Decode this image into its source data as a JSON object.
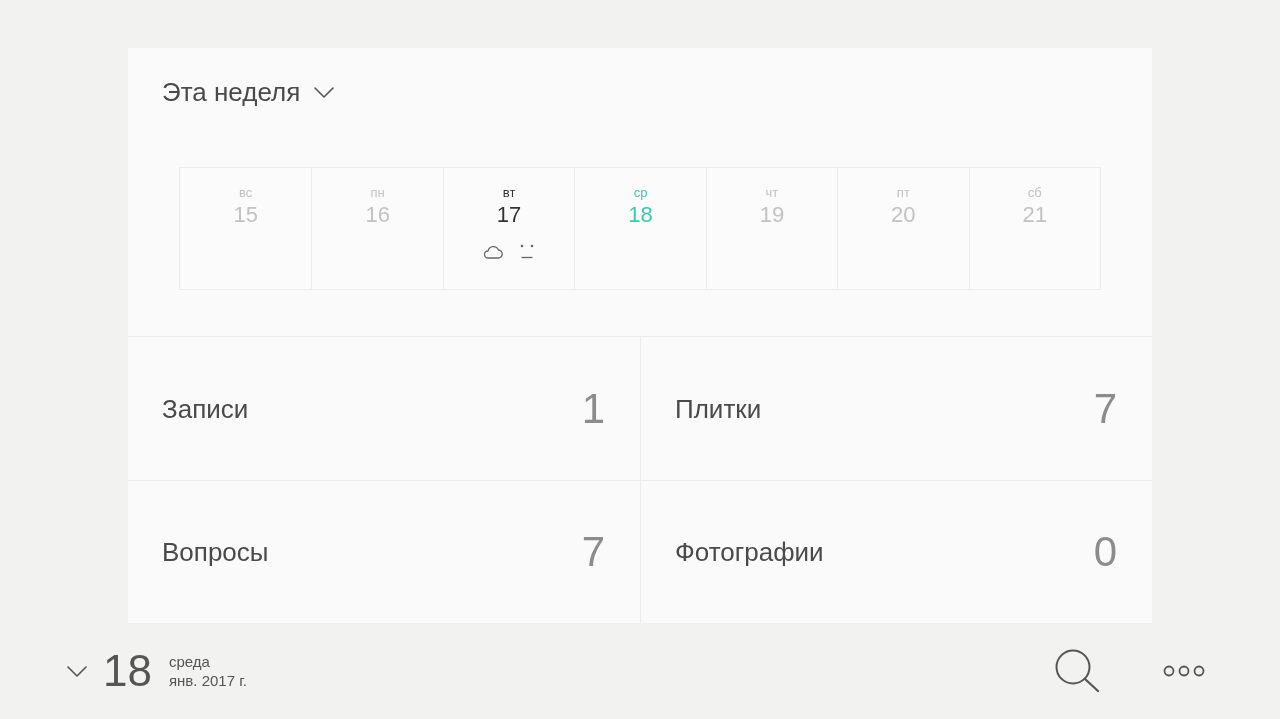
{
  "header": {
    "title": "Эта неделя"
  },
  "week": [
    {
      "weekday": "вс",
      "day": "15",
      "selected": false,
      "has_entries": false
    },
    {
      "weekday": "пн",
      "day": "16",
      "selected": false,
      "has_entries": false
    },
    {
      "weekday": "вт",
      "day": "17",
      "selected": false,
      "has_entries": true
    },
    {
      "weekday": "ср",
      "day": "18",
      "selected": true,
      "has_entries": false
    },
    {
      "weekday": "чт",
      "day": "19",
      "selected": false,
      "has_entries": false
    },
    {
      "weekday": "пт",
      "day": "20",
      "selected": false,
      "has_entries": false
    },
    {
      "weekday": "сб",
      "day": "21",
      "selected": false,
      "has_entries": false
    }
  ],
  "stats": [
    {
      "label": "Записи",
      "count": "1"
    },
    {
      "label": "Плитки",
      "count": "7"
    },
    {
      "label": "Вопросы",
      "count": "7"
    },
    {
      "label": "Фотографии",
      "count": "0"
    }
  ],
  "footer": {
    "day": "18",
    "weekday": "среда",
    "month_year": "янв. 2017 г."
  }
}
